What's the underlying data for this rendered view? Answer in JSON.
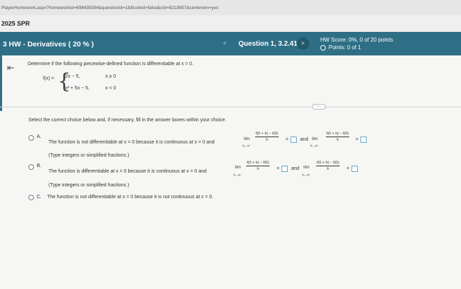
{
  "browser": {
    "url": "PlayerHomework.aspx?homeworkId=698435084&questionId=1&flushed=false&cId=8219857&centerwin=yes"
  },
  "course": {
    "term": "2025 SPR"
  },
  "header": {
    "hw_title": "3 HW - Derivatives ( 20 % )",
    "question_label": "Question 1, 3.2.41",
    "nav_prev": "<",
    "nav_next": ">",
    "score_line": "HW Score: 0%, 0 of 20 points",
    "points_line": "Points: 0 of 1"
  },
  "problem": {
    "prompt": "Determine if the following piecewise-defined function is differentiable at x = 0.",
    "fx_label": "f(x) =",
    "cases": [
      {
        "expr": "2x − 5,",
        "cond": "x ≥ 0"
      },
      {
        "expr": "x² + 5x − 5,",
        "cond": "x < 0"
      }
    ],
    "more_label": "....."
  },
  "instructions": "Select the correct choice below and, if necessary, fill in the answer boxes within your choice.",
  "math": {
    "lim": "lim",
    "sub_left": "h→0⁻",
    "sub_right": "h→0⁺",
    "numerator": "f(0 + h) − f(0)",
    "denominator": "h",
    "equals": "=",
    "and": "and"
  },
  "choices": {
    "a": {
      "letter": "A.",
      "text": "The function is not differentiable at x = 0 because it is continuous at x = 0 and",
      "hint": "(Type integers or simplified fractions.)"
    },
    "b": {
      "letter": "B.",
      "text": "The function is differentiable at x = 0 because it is continuous at x = 0 and",
      "hint": "(Type integers or simplified fractions.)"
    },
    "c": {
      "letter": "C.",
      "text": "The function is not differentiable at x = 0 because it is not continuous at x = 0."
    }
  }
}
